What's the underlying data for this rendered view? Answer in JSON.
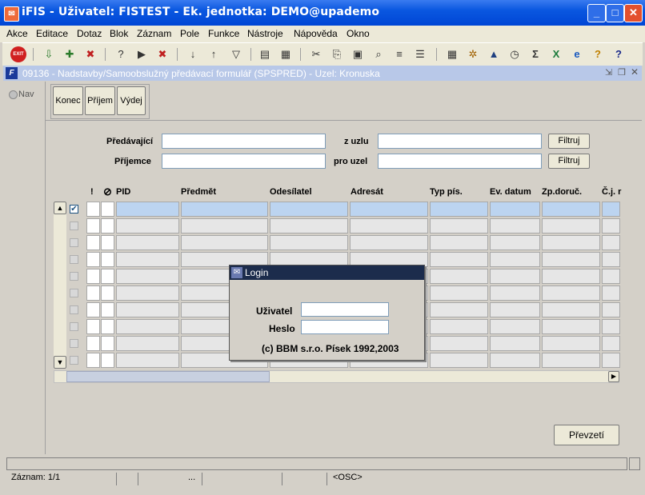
{
  "window": {
    "title": "iFIS - Uživatel: FISTEST - Ek. jednotka: DEMO@upademo",
    "icon": "app-icon",
    "controls": [
      "_",
      "□",
      "✕"
    ]
  },
  "menu": [
    "Akce",
    "Editace",
    "Dotaz",
    "Blok",
    "Záznam",
    "Pole",
    "Funkce",
    "Nástroje",
    "Nápověda",
    "Okno"
  ],
  "toolbar": {
    "exit_label": "EXIT",
    "icons": [
      "save-icon",
      "insert-record-icon",
      "delete-record-icon",
      "query-icon",
      "enter-query-icon",
      "cancel-query-icon",
      "sort-asc-icon",
      "sort-desc-icon",
      "filter-icon",
      "print-icon",
      "print-preview-icon",
      "cut-icon",
      "copy-icon",
      "paste-icon",
      "search-icon",
      "list-icon",
      "list-values-icon",
      "calculator-icon",
      "settings-icon",
      "mountain-icon",
      "clock-icon",
      "sum-icon",
      "excel-icon",
      "internet-icon",
      "help-icon",
      "question-icon"
    ]
  },
  "form": {
    "title": "09136 - Nadstavby/Samoobslužný předávací formulář (SPSPRED) - Uzel: Kronuska",
    "nav_label": "Nav",
    "buttons": {
      "konec": "Konec",
      "prijem": "Příjem",
      "vydej": "Výdej"
    },
    "filters": {
      "predavajici": "Předávající",
      "prijemce": "Příjemce",
      "z_uzlu": "z uzlu",
      "pro_uzel": "pro uzel",
      "filtruj": "Filtruj"
    },
    "columns": [
      "!",
      "PID",
      "Předmět",
      "Odesílatel",
      "Adresát",
      "Typ pís.",
      "Ev. datum",
      "Zp.doruč.",
      "Č.j. r"
    ],
    "prevzeti": "Převzetí"
  },
  "login": {
    "title": "Login",
    "user_label": "Uživatel",
    "password_label": "Heslo",
    "copyright": "(c) BBM s.r.o. Písek  1992,2003"
  },
  "status": {
    "record": "Záznam: 1/1",
    "ellipsis": "...",
    "mode": "<OSC>"
  },
  "colors": {
    "titlebar": "#0a57e0",
    "form_title": "#b8c8e8",
    "selected_row": "#bcd4f0",
    "login_title": "#1c2c4c"
  }
}
